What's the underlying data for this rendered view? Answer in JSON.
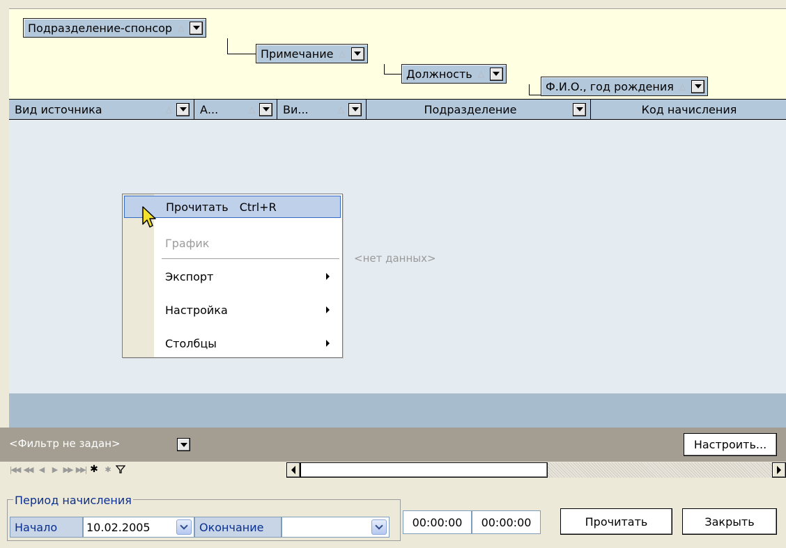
{
  "group_panel": {
    "chips": [
      {
        "label": "Подразделение-спонсор"
      },
      {
        "label": "Примечание"
      },
      {
        "label": "Должность"
      },
      {
        "label": "Ф.И.О., год рождения"
      }
    ],
    "sort_glyph": "△"
  },
  "columns": [
    {
      "label": "Вид источника"
    },
    {
      "label": "А..."
    },
    {
      "label": "Ви..."
    },
    {
      "label": "Подразделение"
    },
    {
      "label": "Код начисления"
    }
  ],
  "grid": {
    "empty_text": "<нет данных>"
  },
  "context_menu": {
    "items": [
      {
        "label": "Прочитать",
        "shortcut": "Ctrl+R",
        "state": "highlighted"
      },
      {
        "label": "График",
        "state": "disabled"
      },
      {
        "label": "Экспорт",
        "submenu": true
      },
      {
        "label": "Настройка",
        "submenu": true
      },
      {
        "label": "Столбцы",
        "submenu": true
      }
    ]
  },
  "filter_bar": {
    "filter_text": "<Фильтр не задан>",
    "configure_button": "Настроить..."
  },
  "navigator": {
    "icons": [
      "first-icon",
      "prev-page-icon",
      "prev-icon",
      "next-icon",
      "next-page-icon",
      "last-icon",
      "insert-icon",
      "delete-icon",
      "filter-icon"
    ]
  },
  "period": {
    "legend": "Период начисления",
    "start_label": "Начало",
    "start_value": "10.02.2005",
    "end_label": "Окончание",
    "end_value": "",
    "time_start": "00:00:00",
    "time_end": "00:00:00"
  },
  "buttons": {
    "read": "Прочитать",
    "close": "Закрыть"
  },
  "colors": {
    "group_panel_bg": "#ffffe1",
    "header_bg": "#b4c8dc",
    "grid_bg": "#e4ebf1",
    "footer_band": "#a7bccd",
    "filter_bar": "#a49e92",
    "menu_highlight": "#bfd0eb"
  }
}
